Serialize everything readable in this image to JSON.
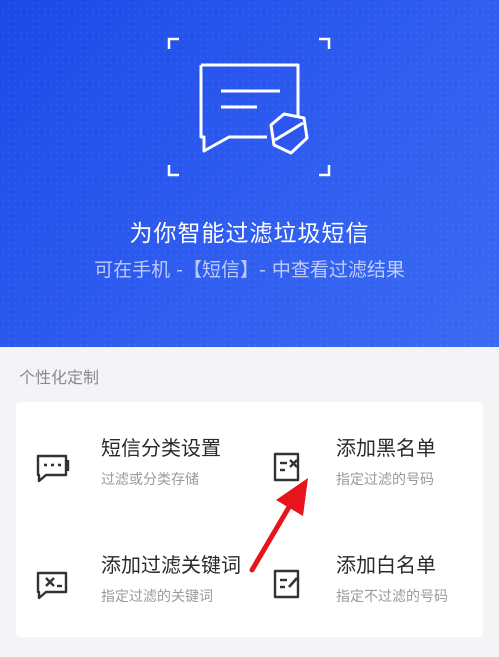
{
  "hero": {
    "title": "为你智能过滤垃圾短信",
    "subtitle": "可在手机 -【短信】- 中查看过滤结果",
    "icon": "message-filter-icon",
    "background_color": "#2352ec"
  },
  "section": {
    "label": "个性化定制"
  },
  "options": [
    {
      "title": "短信分类设置",
      "desc": "过滤或分类存储",
      "icon": "message-settings-icon"
    },
    {
      "title": "添加黑名单",
      "desc": "指定过滤的号码",
      "icon": "blacklist-icon"
    },
    {
      "title": "添加过滤关键词",
      "desc": "指定过滤的关键词",
      "icon": "keyword-filter-icon"
    },
    {
      "title": "添加白名单",
      "desc": "指定不过滤的号码",
      "icon": "whitelist-icon"
    }
  ],
  "annotation": {
    "arrow_color": "#e8141c"
  }
}
